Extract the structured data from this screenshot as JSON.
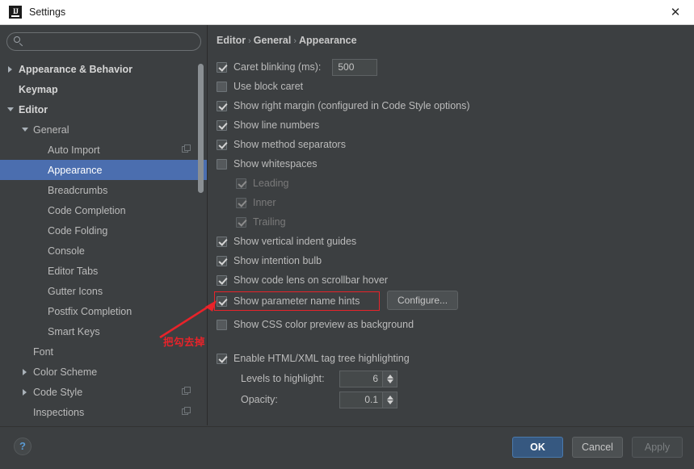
{
  "window": {
    "title": "Settings",
    "logo_icon": "intellij-idea-logo-icon",
    "close_icon": "close-icon"
  },
  "sidebar": {
    "search": {
      "value": "",
      "placeholder": "",
      "icon": "search-icon"
    },
    "items": [
      {
        "label": "Appearance & Behavior",
        "arrow": "right",
        "indent": 0,
        "bold": true,
        "selected": false,
        "icon": null
      },
      {
        "label": "Keymap",
        "arrow": "none",
        "indent": 0,
        "bold": true,
        "selected": false,
        "icon": null
      },
      {
        "label": "Editor",
        "arrow": "down",
        "indent": 0,
        "bold": true,
        "selected": false,
        "icon": null
      },
      {
        "label": "General",
        "arrow": "down",
        "indent": 1,
        "bold": false,
        "selected": false,
        "icon": null
      },
      {
        "label": "Auto Import",
        "arrow": "none",
        "indent": 2,
        "bold": false,
        "selected": false,
        "icon": "copy-icon"
      },
      {
        "label": "Appearance",
        "arrow": "none",
        "indent": 2,
        "bold": false,
        "selected": true,
        "icon": null
      },
      {
        "label": "Breadcrumbs",
        "arrow": "none",
        "indent": 2,
        "bold": false,
        "selected": false,
        "icon": null
      },
      {
        "label": "Code Completion",
        "arrow": "none",
        "indent": 2,
        "bold": false,
        "selected": false,
        "icon": null
      },
      {
        "label": "Code Folding",
        "arrow": "none",
        "indent": 2,
        "bold": false,
        "selected": false,
        "icon": null
      },
      {
        "label": "Console",
        "arrow": "none",
        "indent": 2,
        "bold": false,
        "selected": false,
        "icon": null
      },
      {
        "label": "Editor Tabs",
        "arrow": "none",
        "indent": 2,
        "bold": false,
        "selected": false,
        "icon": null
      },
      {
        "label": "Gutter Icons",
        "arrow": "none",
        "indent": 2,
        "bold": false,
        "selected": false,
        "icon": null
      },
      {
        "label": "Postfix Completion",
        "arrow": "none",
        "indent": 2,
        "bold": false,
        "selected": false,
        "icon": null
      },
      {
        "label": "Smart Keys",
        "arrow": "none",
        "indent": 2,
        "bold": false,
        "selected": false,
        "icon": null
      },
      {
        "label": "Font",
        "arrow": "none",
        "indent": 1,
        "bold": false,
        "selected": false,
        "icon": null
      },
      {
        "label": "Color Scheme",
        "arrow": "right",
        "indent": 1,
        "bold": false,
        "selected": false,
        "icon": null
      },
      {
        "label": "Code Style",
        "arrow": "right",
        "indent": 1,
        "bold": false,
        "selected": false,
        "icon": "copy-icon"
      },
      {
        "label": "Inspections",
        "arrow": "none",
        "indent": 1,
        "bold": false,
        "selected": false,
        "icon": "copy-icon"
      }
    ],
    "scrollbar": "vertical-scrollbar"
  },
  "main": {
    "breadcrumb": {
      "parts": [
        "Editor",
        "General",
        "Appearance"
      ],
      "separator": "›"
    },
    "options": [
      {
        "label": "Caret blinking (ms):",
        "checked": true,
        "enabled": true,
        "indent": 0
      },
      {
        "label": "Use block caret",
        "checked": false,
        "enabled": true,
        "indent": 0
      },
      {
        "label": "Show right margin (configured in Code Style options)",
        "checked": true,
        "enabled": true,
        "indent": 0
      },
      {
        "label": "Show line numbers",
        "checked": true,
        "enabled": true,
        "indent": 0
      },
      {
        "label": "Show method separators",
        "checked": true,
        "enabled": true,
        "indent": 0
      },
      {
        "label": "Show whitespaces",
        "checked": false,
        "enabled": true,
        "indent": 0
      },
      {
        "label": "Leading",
        "checked": true,
        "enabled": false,
        "indent": 1
      },
      {
        "label": "Inner",
        "checked": true,
        "enabled": false,
        "indent": 1
      },
      {
        "label": "Trailing",
        "checked": true,
        "enabled": false,
        "indent": 1
      },
      {
        "label": "Show vertical indent guides",
        "checked": true,
        "enabled": true,
        "indent": 0
      },
      {
        "label": "Show intention bulb",
        "checked": true,
        "enabled": true,
        "indent": 0
      },
      {
        "label": "Show code lens on scrollbar hover",
        "checked": true,
        "enabled": true,
        "indent": 0
      },
      {
        "label": "Show parameter name hints",
        "checked": true,
        "enabled": true,
        "indent": 0
      },
      {
        "label": "Show CSS color preview as background",
        "checked": false,
        "enabled": true,
        "indent": 0
      },
      {
        "label": "Enable HTML/XML tag tree highlighting",
        "checked": true,
        "enabled": true,
        "indent": 0
      }
    ],
    "caret_blinking_value": "500",
    "configure_label": "Configure...",
    "levels_label": "Levels to highlight:",
    "levels_value": "6",
    "opacity_label": "Opacity:",
    "opacity_value": "0.1"
  },
  "annotation": {
    "text": "把勾去掉",
    "color": "#e8232a",
    "target": "Show parameter name hints"
  },
  "footer": {
    "help_label": "?",
    "ok_label": "OK",
    "cancel_label": "Cancel",
    "apply_label": "Apply"
  },
  "colors": {
    "background": "#3c3f41",
    "selection": "#4b6eaf",
    "accent": "#365880",
    "annotation": "#e8232a",
    "titlebar": "#ffffff"
  }
}
